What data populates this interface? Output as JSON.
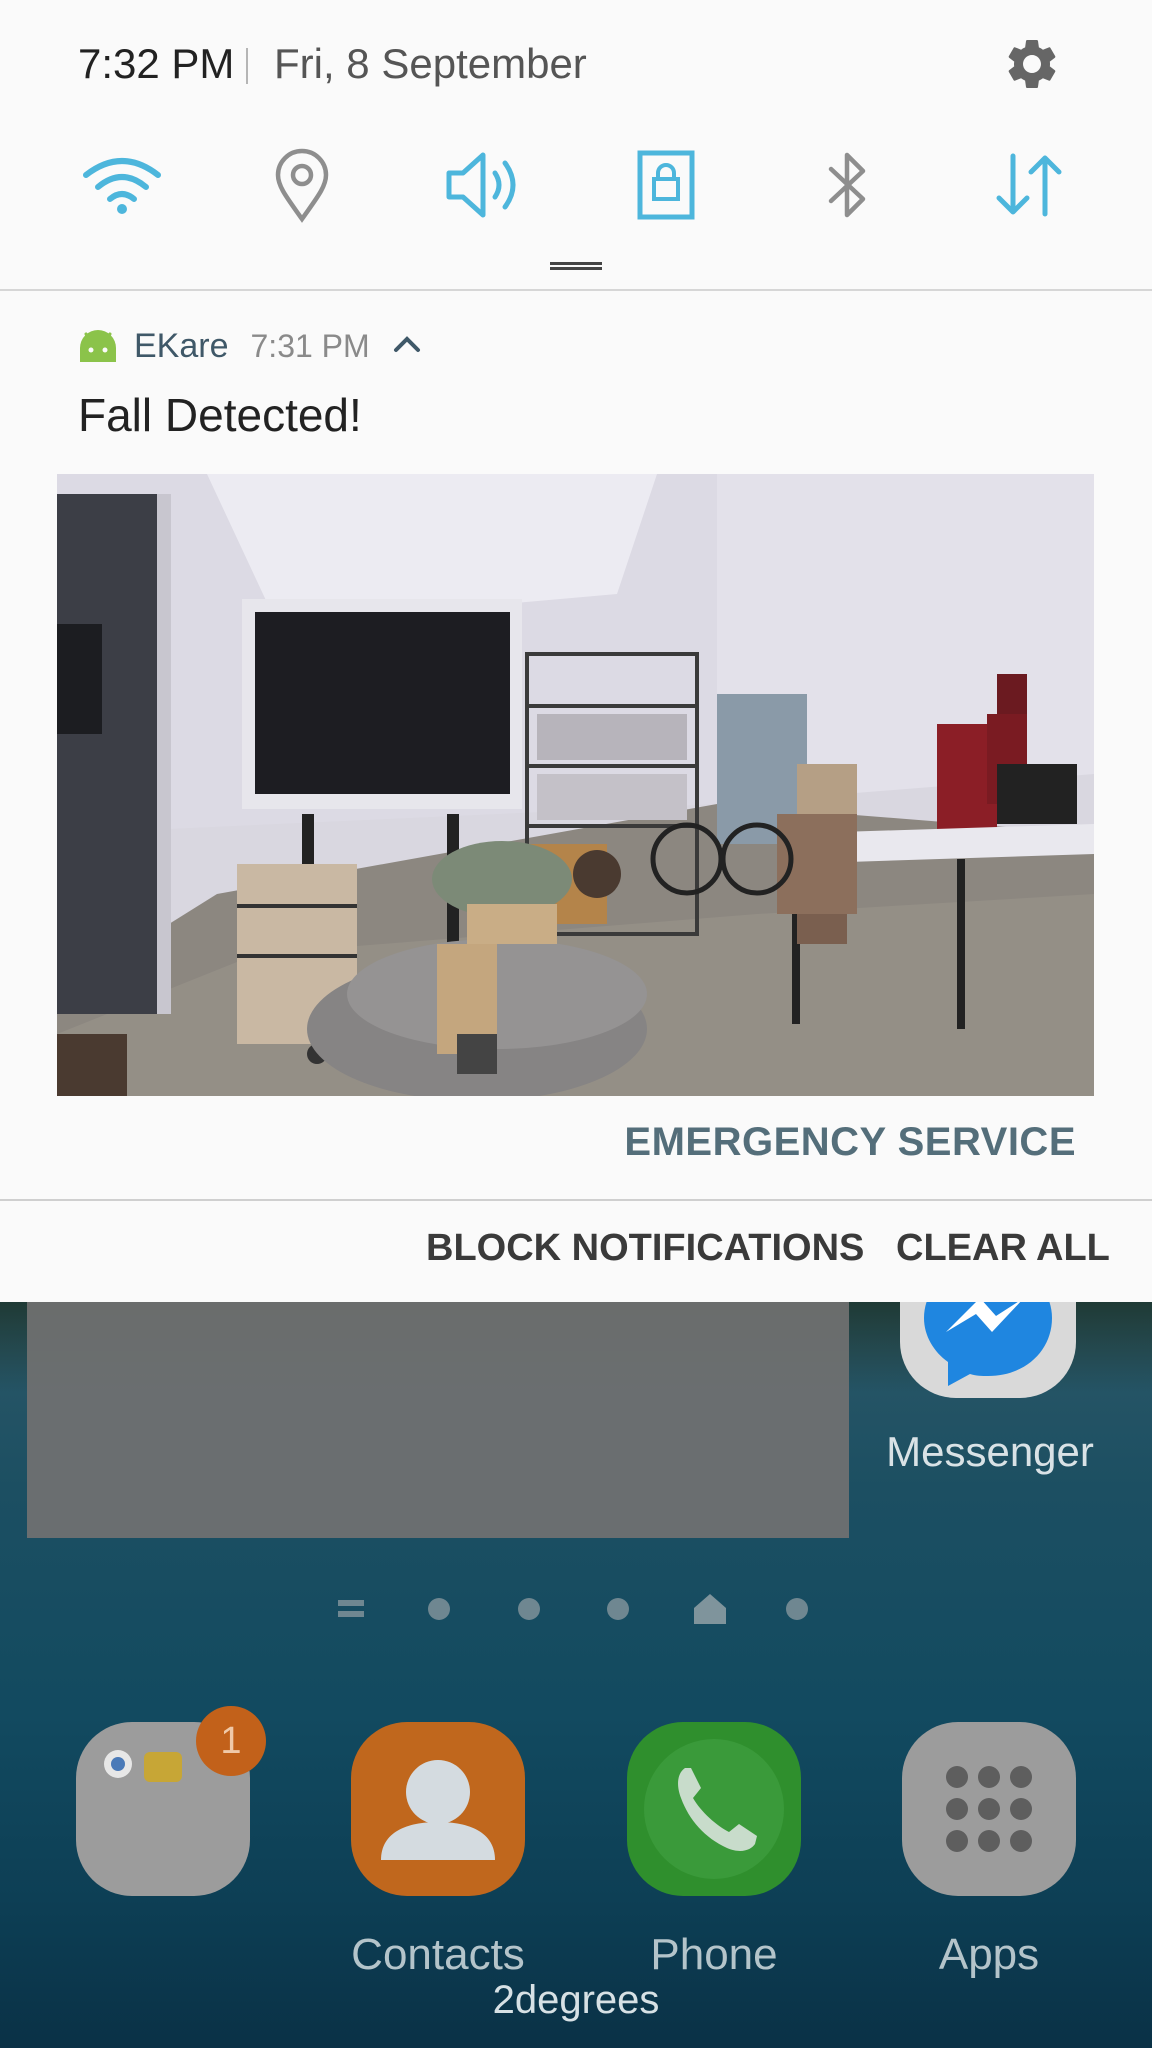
{
  "status": {
    "time": "7:32 PM",
    "date": "Fri, 8 September"
  },
  "quick_toggles": [
    {
      "name": "wifi",
      "icon": "wifi-icon",
      "state": "on"
    },
    {
      "name": "location",
      "icon": "location-icon",
      "state": "off"
    },
    {
      "name": "sound",
      "icon": "sound-icon",
      "state": "on"
    },
    {
      "name": "screen-rotation-lock",
      "icon": "lock-screen-icon",
      "state": "on"
    },
    {
      "name": "bluetooth",
      "icon": "bluetooth-icon",
      "state": "off"
    },
    {
      "name": "mobile-data",
      "icon": "data-transfer-icon",
      "state": "on"
    }
  ],
  "notification": {
    "app_name": "EKare",
    "time": "7:31 PM",
    "title": "Fall Detected!",
    "action_label": "EMERGENCY SERVICE"
  },
  "footer_actions": {
    "block_label": "BLOCK NOTIFICATIONS",
    "clear_label": "CLEAR ALL"
  },
  "home": {
    "apps": [
      {
        "label": "Messenger",
        "icon": "messenger-icon"
      },
      {
        "label": "",
        "icon": "folder-icon",
        "badge": "1"
      },
      {
        "label": "Contacts",
        "icon": "contacts-icon"
      },
      {
        "label": "Phone",
        "icon": "phone-icon"
      },
      {
        "label": "Apps",
        "icon": "apps-grid-icon"
      }
    ],
    "carrier": "2degrees"
  },
  "colors": {
    "accent": "#4db6dc",
    "inactive": "#8e8e8e",
    "action_text": "#546e7a",
    "badge": "#c2611a"
  }
}
